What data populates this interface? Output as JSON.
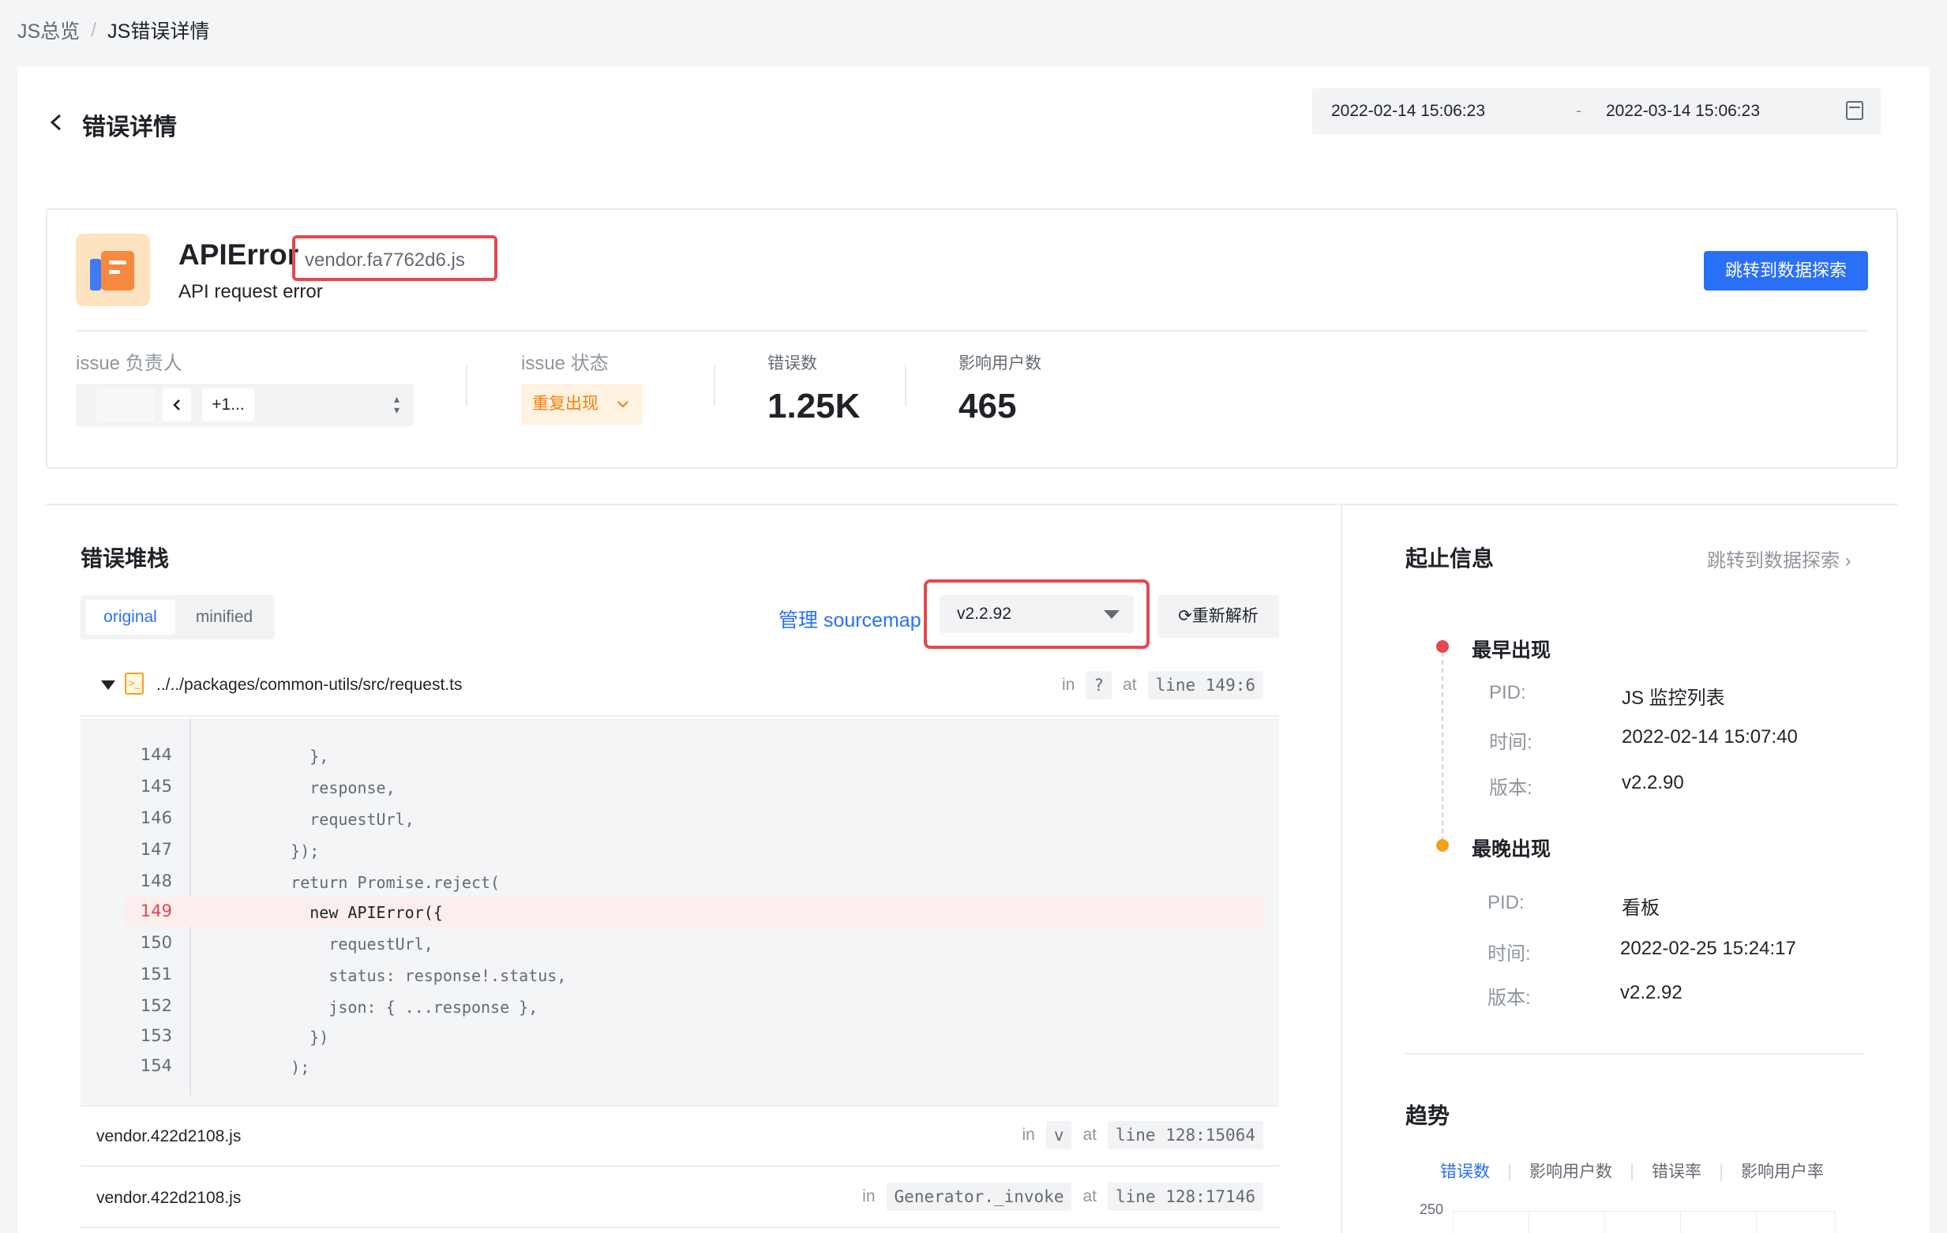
{
  "breadcrumb": {
    "root": "JS总览",
    "separator": "/",
    "current": "JS错误详情"
  },
  "header": {
    "back_icon": "chevron-left-icon",
    "title": "错误详情"
  },
  "date_range": {
    "start": "2022-02-14 15:06:23",
    "separator": "-",
    "end": "2022-03-14 15:06:23",
    "icon": "calendar-icon"
  },
  "error": {
    "name": "APIError",
    "file": "vendor.fa7762d6.js",
    "message": "API request error",
    "jump_button": "跳转到数据探索"
  },
  "meta": {
    "assignee_label": "issue 负责人",
    "assignee_more": "+1...",
    "status_label": "issue 状态",
    "status_value": "重复出现",
    "error_count_label": "错误数",
    "error_count": "1.25K",
    "affected_users_label": "影响用户数",
    "affected_users": "465"
  },
  "stack": {
    "title": "错误堆栈",
    "views": [
      "original",
      "minified"
    ],
    "active_view": "original",
    "manage_link": "管理 sourcemap",
    "version": "v2.2.92",
    "reparse_button": "重新解析",
    "frames": [
      {
        "path": "../../packages/common-utils/src/request.ts",
        "in_label": "in",
        "func": "?",
        "at_label": "at",
        "location": "line 149:6"
      },
      {
        "path": "vendor.422d2108.js",
        "in_label": "in",
        "func": "v",
        "at_label": "at",
        "location": "line 128:15064"
      },
      {
        "path": "vendor.422d2108.js",
        "in_label": "in",
        "func": "Generator._invoke",
        "at_label": "at",
        "location": "line 128:17146"
      }
    ],
    "code": [
      {
        "num": "144",
        "text": "      },"
      },
      {
        "num": "145",
        "text": "      response,"
      },
      {
        "num": "146",
        "text": "      requestUrl,"
      },
      {
        "num": "147",
        "text": "    });"
      },
      {
        "num": "148",
        "text": "    return Promise.reject("
      },
      {
        "num": "149",
        "text": "      new APIError({"
      },
      {
        "num": "150",
        "text": "        requestUrl,"
      },
      {
        "num": "151",
        "text": "        status: response!.status,"
      },
      {
        "num": "152",
        "text": "        json: { ...response },"
      },
      {
        "num": "153",
        "text": "      })"
      },
      {
        "num": "154",
        "text": "    );"
      }
    ],
    "highlight_line": "149"
  },
  "lifecycle": {
    "title": "起止信息",
    "link": "跳转到数据探索",
    "earliest": {
      "title": "最早出现",
      "pid_label": "PID:",
      "pid": "JS 监控列表",
      "time_label": "时间:",
      "time": "2022-02-14 15:07:40",
      "version_label": "版本:",
      "version": "v2.2.90"
    },
    "latest": {
      "title": "最晚出现",
      "pid_label": "PID:",
      "pid": "看板",
      "time_label": "时间:",
      "time": "2022-02-25 15:24:17",
      "version_label": "版本:",
      "version": "v2.2.92"
    }
  },
  "trend": {
    "title": "趋势",
    "tabs": [
      "错误数",
      "影响用户数",
      "错误率",
      "影响用户率"
    ],
    "y_top_label": "250"
  },
  "colors": {
    "accent": "#2a70f6",
    "danger": "#e5484d",
    "warning": "#f77e0b",
    "earliest_dot": "#e5484d",
    "latest_dot": "#f2a11c"
  }
}
